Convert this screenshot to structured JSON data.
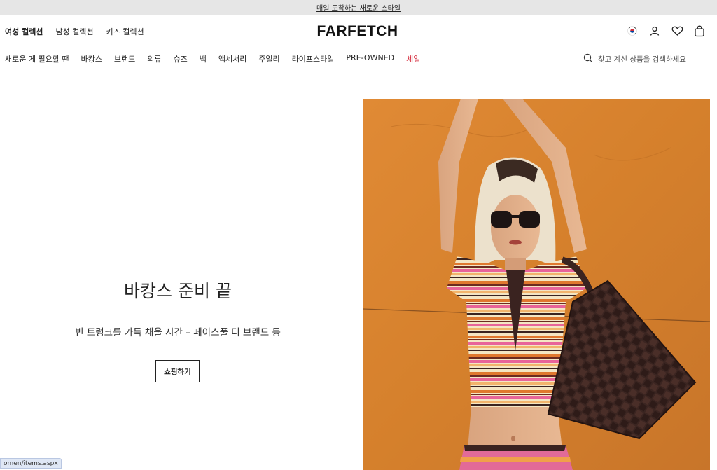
{
  "promo": {
    "text": "매일 도착하는 새로운 스타일"
  },
  "gender_nav": [
    {
      "label": "여성 컬렉션",
      "active": true
    },
    {
      "label": "남성 컬렉션",
      "active": false
    },
    {
      "label": "키즈 컬렉션",
      "active": false
    }
  ],
  "logo": {
    "text": "FARFETCH"
  },
  "header_icons": [
    "korea-flag-icon",
    "account-icon",
    "wishlist-heart-icon",
    "shopping-bag-icon"
  ],
  "categories": [
    {
      "label": "새로운 게 필요할 땐"
    },
    {
      "label": "바캉스"
    },
    {
      "label": "브랜드"
    },
    {
      "label": "의류"
    },
    {
      "label": "슈즈"
    },
    {
      "label": "백"
    },
    {
      "label": "액세서리"
    },
    {
      "label": "주얼리"
    },
    {
      "label": "라이프스타일"
    },
    {
      "label": "PRE-OWNED"
    },
    {
      "label": "세일"
    }
  ],
  "search": {
    "placeholder": "찾고 계신 상품을 검색하세요"
  },
  "hero": {
    "title": "바캉스 준비 끝",
    "subtitle": "빈 트렁크를 가득 채울 시간 – 페이스풀 더 브랜드 등",
    "button_label": "쇼핑하기"
  },
  "status_bar": {
    "url": "omen/items.aspx"
  },
  "colors": {
    "sale": "#d1182b",
    "hero_bg": "#d9822f",
    "promo_bg": "#e6e6e6"
  }
}
